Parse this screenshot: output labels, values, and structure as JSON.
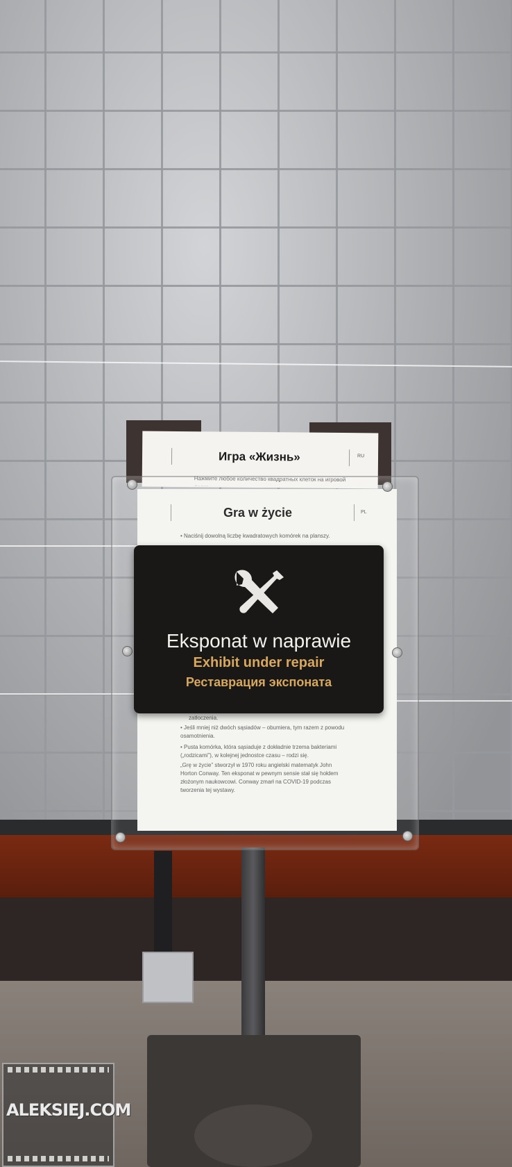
{
  "ru_sheet": {
    "title": "Игра «Жизнь»",
    "lang": "RU",
    "peek_text": "Нажмите любое количество квадратных клеток на игровой доске."
  },
  "pl_sheet": {
    "title": "Gra w życie",
    "lang": "PL",
    "rule_1": "Naciśnij dowolną liczbę kwadratowych komórek na planszy.",
    "rule_2_tail": "zatłoczenia.",
    "rule_3": "Jeśli mniej niż dwóch sąsiadów – obumiera, tym razem z powodu osamotnienia.",
    "rule_4": "Pusta komórka, która sąsiaduje z dokładnie trzema bakteriami („rodzicami”), w kolejnej jednostce czasu – rodzi się.",
    "footer": "„Grę w życie” stworzył w 1970 roku angielski matematyk John Horton Conway. Ten eksponat w pewnym sensie stał się hołdem złożonym naukowcowi. Conway zmarł na COVID-19 podczas tworzenia tej wystawy."
  },
  "repair_sign": {
    "icon": "wrench-screwdriver-icon",
    "line_pl": "Eksponat w naprawie",
    "line_en": "Exhibit under repair",
    "line_ru": "Реставрация экспоната",
    "color_pl": "#f4f2ee",
    "color_accent": "#d7a85e"
  },
  "watermark": {
    "text": "ALEKSIEJ.COM"
  }
}
